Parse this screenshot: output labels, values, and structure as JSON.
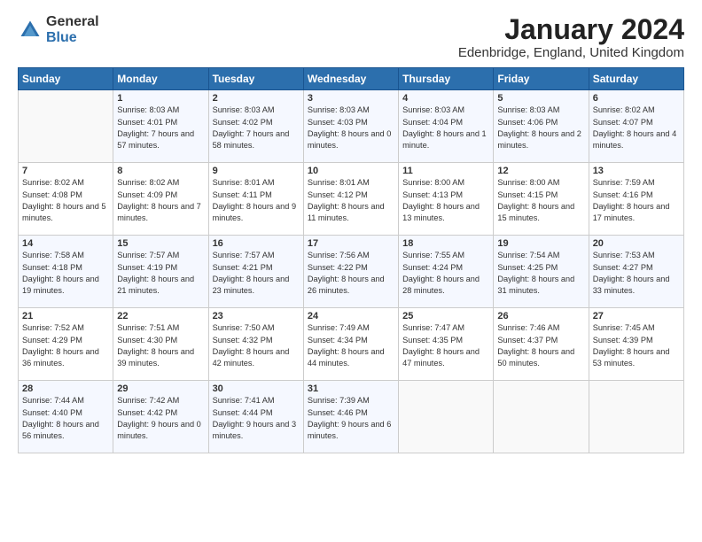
{
  "logo": {
    "general": "General",
    "blue": "Blue"
  },
  "title": "January 2024",
  "location": "Edenbridge, England, United Kingdom",
  "days_header": [
    "Sunday",
    "Monday",
    "Tuesday",
    "Wednesday",
    "Thursday",
    "Friday",
    "Saturday"
  ],
  "weeks": [
    [
      {
        "day": "",
        "sunrise": "",
        "sunset": "",
        "daylight": ""
      },
      {
        "day": "1",
        "sunrise": "Sunrise: 8:03 AM",
        "sunset": "Sunset: 4:01 PM",
        "daylight": "Daylight: 7 hours and 57 minutes."
      },
      {
        "day": "2",
        "sunrise": "Sunrise: 8:03 AM",
        "sunset": "Sunset: 4:02 PM",
        "daylight": "Daylight: 7 hours and 58 minutes."
      },
      {
        "day": "3",
        "sunrise": "Sunrise: 8:03 AM",
        "sunset": "Sunset: 4:03 PM",
        "daylight": "Daylight: 8 hours and 0 minutes."
      },
      {
        "day": "4",
        "sunrise": "Sunrise: 8:03 AM",
        "sunset": "Sunset: 4:04 PM",
        "daylight": "Daylight: 8 hours and 1 minute."
      },
      {
        "day": "5",
        "sunrise": "Sunrise: 8:03 AM",
        "sunset": "Sunset: 4:06 PM",
        "daylight": "Daylight: 8 hours and 2 minutes."
      },
      {
        "day": "6",
        "sunrise": "Sunrise: 8:02 AM",
        "sunset": "Sunset: 4:07 PM",
        "daylight": "Daylight: 8 hours and 4 minutes."
      }
    ],
    [
      {
        "day": "7",
        "sunrise": "Sunrise: 8:02 AM",
        "sunset": "Sunset: 4:08 PM",
        "daylight": "Daylight: 8 hours and 5 minutes."
      },
      {
        "day": "8",
        "sunrise": "Sunrise: 8:02 AM",
        "sunset": "Sunset: 4:09 PM",
        "daylight": "Daylight: 8 hours and 7 minutes."
      },
      {
        "day": "9",
        "sunrise": "Sunrise: 8:01 AM",
        "sunset": "Sunset: 4:11 PM",
        "daylight": "Daylight: 8 hours and 9 minutes."
      },
      {
        "day": "10",
        "sunrise": "Sunrise: 8:01 AM",
        "sunset": "Sunset: 4:12 PM",
        "daylight": "Daylight: 8 hours and 11 minutes."
      },
      {
        "day": "11",
        "sunrise": "Sunrise: 8:00 AM",
        "sunset": "Sunset: 4:13 PM",
        "daylight": "Daylight: 8 hours and 13 minutes."
      },
      {
        "day": "12",
        "sunrise": "Sunrise: 8:00 AM",
        "sunset": "Sunset: 4:15 PM",
        "daylight": "Daylight: 8 hours and 15 minutes."
      },
      {
        "day": "13",
        "sunrise": "Sunrise: 7:59 AM",
        "sunset": "Sunset: 4:16 PM",
        "daylight": "Daylight: 8 hours and 17 minutes."
      }
    ],
    [
      {
        "day": "14",
        "sunrise": "Sunrise: 7:58 AM",
        "sunset": "Sunset: 4:18 PM",
        "daylight": "Daylight: 8 hours and 19 minutes."
      },
      {
        "day": "15",
        "sunrise": "Sunrise: 7:57 AM",
        "sunset": "Sunset: 4:19 PM",
        "daylight": "Daylight: 8 hours and 21 minutes."
      },
      {
        "day": "16",
        "sunrise": "Sunrise: 7:57 AM",
        "sunset": "Sunset: 4:21 PM",
        "daylight": "Daylight: 8 hours and 23 minutes."
      },
      {
        "day": "17",
        "sunrise": "Sunrise: 7:56 AM",
        "sunset": "Sunset: 4:22 PM",
        "daylight": "Daylight: 8 hours and 26 minutes."
      },
      {
        "day": "18",
        "sunrise": "Sunrise: 7:55 AM",
        "sunset": "Sunset: 4:24 PM",
        "daylight": "Daylight: 8 hours and 28 minutes."
      },
      {
        "day": "19",
        "sunrise": "Sunrise: 7:54 AM",
        "sunset": "Sunset: 4:25 PM",
        "daylight": "Daylight: 8 hours and 31 minutes."
      },
      {
        "day": "20",
        "sunrise": "Sunrise: 7:53 AM",
        "sunset": "Sunset: 4:27 PM",
        "daylight": "Daylight: 8 hours and 33 minutes."
      }
    ],
    [
      {
        "day": "21",
        "sunrise": "Sunrise: 7:52 AM",
        "sunset": "Sunset: 4:29 PM",
        "daylight": "Daylight: 8 hours and 36 minutes."
      },
      {
        "day": "22",
        "sunrise": "Sunrise: 7:51 AM",
        "sunset": "Sunset: 4:30 PM",
        "daylight": "Daylight: 8 hours and 39 minutes."
      },
      {
        "day": "23",
        "sunrise": "Sunrise: 7:50 AM",
        "sunset": "Sunset: 4:32 PM",
        "daylight": "Daylight: 8 hours and 42 minutes."
      },
      {
        "day": "24",
        "sunrise": "Sunrise: 7:49 AM",
        "sunset": "Sunset: 4:34 PM",
        "daylight": "Daylight: 8 hours and 44 minutes."
      },
      {
        "day": "25",
        "sunrise": "Sunrise: 7:47 AM",
        "sunset": "Sunset: 4:35 PM",
        "daylight": "Daylight: 8 hours and 47 minutes."
      },
      {
        "day": "26",
        "sunrise": "Sunrise: 7:46 AM",
        "sunset": "Sunset: 4:37 PM",
        "daylight": "Daylight: 8 hours and 50 minutes."
      },
      {
        "day": "27",
        "sunrise": "Sunrise: 7:45 AM",
        "sunset": "Sunset: 4:39 PM",
        "daylight": "Daylight: 8 hours and 53 minutes."
      }
    ],
    [
      {
        "day": "28",
        "sunrise": "Sunrise: 7:44 AM",
        "sunset": "Sunset: 4:40 PM",
        "daylight": "Daylight: 8 hours and 56 minutes."
      },
      {
        "day": "29",
        "sunrise": "Sunrise: 7:42 AM",
        "sunset": "Sunset: 4:42 PM",
        "daylight": "Daylight: 9 hours and 0 minutes."
      },
      {
        "day": "30",
        "sunrise": "Sunrise: 7:41 AM",
        "sunset": "Sunset: 4:44 PM",
        "daylight": "Daylight: 9 hours and 3 minutes."
      },
      {
        "day": "31",
        "sunrise": "Sunrise: 7:39 AM",
        "sunset": "Sunset: 4:46 PM",
        "daylight": "Daylight: 9 hours and 6 minutes."
      },
      {
        "day": "",
        "sunrise": "",
        "sunset": "",
        "daylight": ""
      },
      {
        "day": "",
        "sunrise": "",
        "sunset": "",
        "daylight": ""
      },
      {
        "day": "",
        "sunrise": "",
        "sunset": "",
        "daylight": ""
      }
    ]
  ]
}
